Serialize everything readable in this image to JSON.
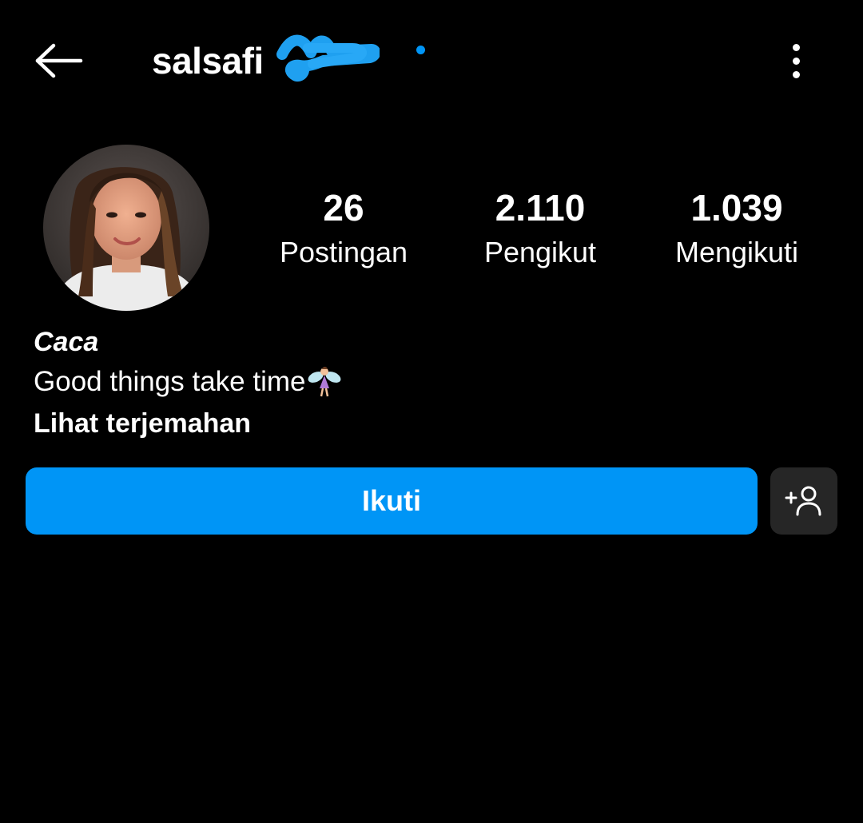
{
  "header": {
    "username": "salsafi",
    "back_icon": "arrow-left-icon",
    "more_icon": "more-vertical-icon",
    "accent_color": "#0095f6"
  },
  "stats": [
    {
      "value": "26",
      "label": "Postingan"
    },
    {
      "value": "2.110",
      "label": "Pengikut"
    },
    {
      "value": "1.039",
      "label": "Mengikuti"
    }
  ],
  "bio": {
    "name": "Caca",
    "text": "Good things take time",
    "emoji": "fairy-emoji",
    "translate_label": "Lihat terjemahan"
  },
  "actions": {
    "follow_label": "Ikuti",
    "follow_color": "#0095f6",
    "suggest_icon": "add-person-icon"
  }
}
